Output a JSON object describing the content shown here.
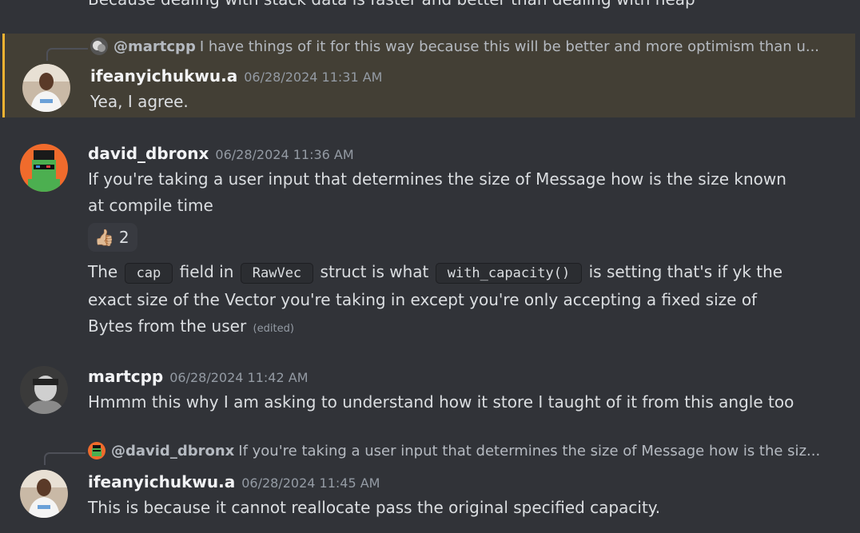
{
  "cutoff_text": "Because dealing with stack data is faster and better than dealing with heap",
  "messages": [
    {
      "reply": {
        "name": "@martcpp",
        "text": "I have things of it for this way because this will be better and more optimism than u..."
      },
      "author": "ifeanyichukwu.a",
      "timestamp": "06/28/2024 11:31 AM",
      "text": "Yea, I agree.",
      "highlighted": true
    },
    {
      "author": "david_dbronx",
      "timestamp": "06/28/2024 11:36 AM",
      "text": "If you're taking a user input that determines the size of Message how is the size known at compile time",
      "reaction": {
        "emoji": "👍🏼",
        "count": "2"
      },
      "followup": {
        "t1": "The ",
        "c1": "cap",
        "t2": " field in ",
        "c2": "RawVec",
        "t3": " struct is what ",
        "c3": "with_capacity()",
        "t4": " is setting that's if yk the exact size of the Vector you're taking in except you're only accepting a fixed size of Bytes from the user",
        "edited": "(edited)"
      }
    },
    {
      "author": "martcpp",
      "timestamp": "06/28/2024 11:42 AM",
      "text": "Hmmm this why I am asking to understand how it store I taught of it from this angle too"
    },
    {
      "reply": {
        "name": "@david_dbronx",
        "text": "If you're taking a user input that determines the size of Message how is the siz..."
      },
      "author": "ifeanyichukwu.a",
      "timestamp": "06/28/2024 11:45 AM",
      "text": "This is because it cannot reallocate pass the original specified capacity."
    }
  ],
  "colors": {
    "background": "#313338",
    "highlight_bg": "#433f35",
    "highlight_border": "#f0b232",
    "username": "#f2f3f5",
    "timestamp": "#949ba4"
  }
}
